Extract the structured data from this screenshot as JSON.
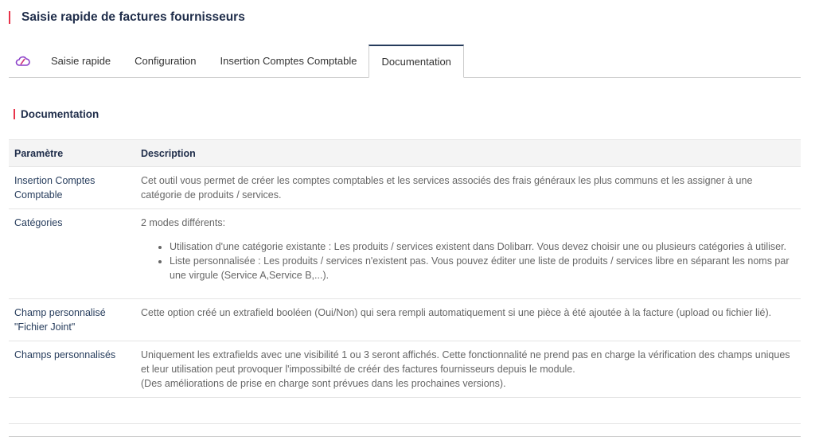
{
  "header": {
    "title": "Saisie rapide de factures fournisseurs"
  },
  "tabs": [
    {
      "label": "Saisie rapide"
    },
    {
      "label": "Configuration"
    },
    {
      "label": "Insertion Comptes Comptable"
    },
    {
      "label": "Documentation",
      "active": true
    }
  ],
  "icons": {
    "module": "cloud-link-icon"
  },
  "colors": {
    "accent_bar": "#e8334a",
    "title": "#1f2d4a",
    "module_icon": "#8a3fc9"
  },
  "section": {
    "title": "Documentation"
  },
  "table": {
    "headers": [
      "Paramètre",
      "Description"
    ],
    "rows": [
      {
        "param": "Insertion Comptes Comptable",
        "desc": "Cet outil vous permet de créer les comptes comptables et les services associés des frais généraux les plus communs et les assigner à une catégorie de produits / services."
      },
      {
        "param": "Catégories",
        "desc": "2 modes différents:",
        "bullets": [
          "Utilisation d'une catégorie existante : Les produits / services existent dans Dolibarr. Vous devez choisir une ou plusieurs catégories à utiliser.",
          "Liste personnalisée : Les produits / services n'existent pas. Vous pouvez éditer une liste de produits / services libre en séparant les noms par une virgule (Service A,Service B,...)."
        ]
      },
      {
        "param": "Champ personnalisé \"Fichier Joint\"",
        "desc": "Cette option créé un extrafield booléen (Oui/Non) qui sera rempli automatiquement si une pièce à été ajoutée à la facture (upload ou fichier lié)."
      },
      {
        "param": "Champs personnalisés",
        "desc": "Uniquement les extrafields avec une visibilité 1 ou 3 seront affichés. Cette fonctionnalité ne prend pas en charge la vérification des champs uniques et leur utilisation peut provoquer l'impossibilté de créér des factures fournisseurs depuis le module.",
        "note": "(Des améliorations de prise en charge sont prévues dans les prochaines versions)."
      }
    ]
  }
}
